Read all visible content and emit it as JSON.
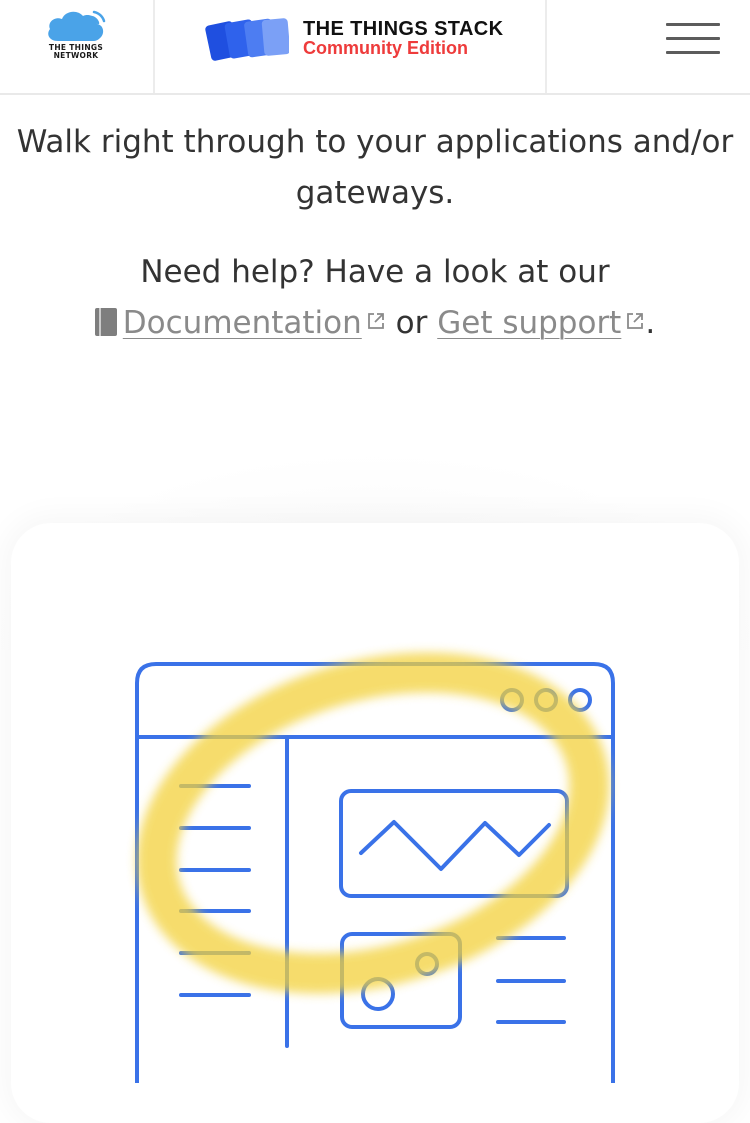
{
  "header": {
    "ttn_logo_line1": "THE THINGS",
    "ttn_logo_line2": "NETWORK",
    "stack_title": "THE THINGS STACK",
    "stack_subtitle": "Community Edition",
    "menu_icon": "hamburger-menu-icon"
  },
  "intro": {
    "text": "Walk right through to your applications and/or gateways."
  },
  "help": {
    "prefix": "Need help? Have a look at our",
    "documentation_label": "Documentation",
    "or_text": "or",
    "support_label": "Get support",
    "suffix": "."
  },
  "colors": {
    "brand_red": "#ee3b3b",
    "brand_blue": "#3a72e8",
    "highlight_yellow": "#f3d13a",
    "link_gray": "#8a8a8a"
  }
}
